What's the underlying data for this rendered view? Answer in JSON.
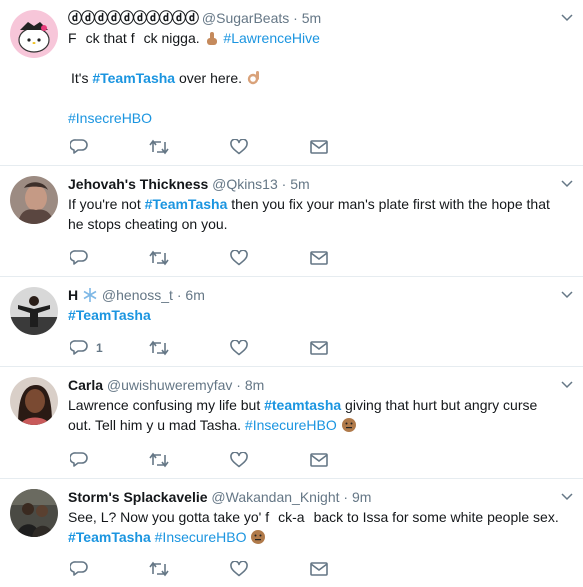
{
  "tweets": [
    {
      "name": "ⓓⓓⓓⓓⓓⓓⓓⓓⓓⓓ",
      "handle": "@SugarBeats",
      "time": "5m",
      "line1_a": "F",
      "line1_b": "ck that f",
      "line1_c": "ck nigga.",
      "line1_tag": "#LawrenceHive",
      "line2_a": "It's",
      "line2_tag": "#TeamTasha",
      "line2_b": "over here.",
      "line3_tag": "#InsecreHBO",
      "avatar_color": "#f4b8cf"
    },
    {
      "name": "Jehovah's Thickness",
      "handle": "@Qkins13",
      "time": "5m",
      "text_a": "If you're not",
      "tag": "#TeamTasha",
      "text_b": "then you fix your man's plate first with the hope that he stops cheating on you.",
      "avatar_color": "#8a7a72"
    },
    {
      "name": "H",
      "handle": "@henoss_t",
      "time": "6m",
      "tag": "#TeamTasha",
      "reply_count": "1",
      "avatar_color": "#2b2b2b"
    },
    {
      "name": "Carla",
      "handle": "@uwishuweremyfav",
      "time": "8m",
      "text_a": "Lawrence confusing my life but",
      "tag": "#teamtasha",
      "text_b": "giving that hurt but angry curse out. Tell him y u mad Tasha.",
      "tag2": "#InsecureHBO",
      "avatar_color": "#5a3a2a"
    },
    {
      "name": "Storm's Splackavelie",
      "handle": "@Wakandan_Knight",
      "time": "9m",
      "text_a": "See, L? Now you gotta take yo' f",
      "text_b": "ck-a",
      "text_c": "back to Issa for some white people sex.",
      "tag": "#TeamTasha",
      "tag2": "#InsecureHBO",
      "avatar_color": "#3a3a3a"
    }
  ],
  "separator": "·",
  "colors": {
    "link": "#1b95e0",
    "muted": "#657786",
    "divider": "#e6ecf0",
    "icon": "#657786"
  },
  "icons": [
    "reply-icon",
    "retweet-icon",
    "like-icon",
    "dm-icon",
    "chevron-down-icon",
    "snowflake-icon",
    "hand-emoji-icon",
    "ok-hand-emoji-icon",
    "face-emoji-icon"
  ]
}
